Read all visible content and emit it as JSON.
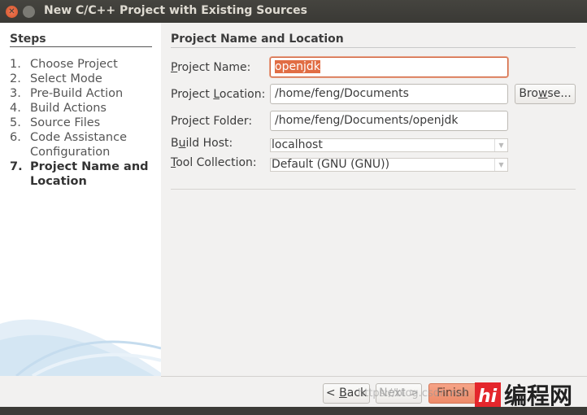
{
  "window": {
    "title": "New C/C++ Project with Existing Sources"
  },
  "steps": {
    "heading": "Steps",
    "items": [
      {
        "num": "1.",
        "label": "Choose Project"
      },
      {
        "num": "2.",
        "label": "Select Mode"
      },
      {
        "num": "3.",
        "label": "Pre-Build Action"
      },
      {
        "num": "4.",
        "label": "Build Actions"
      },
      {
        "num": "5.",
        "label": "Source Files"
      },
      {
        "num": "6.",
        "label": "Code Assistance Configuration"
      },
      {
        "num": "7.",
        "label": "Project Name and Location",
        "current": true
      }
    ]
  },
  "form": {
    "heading": "Project Name and Location",
    "project_name": {
      "label_u": "P",
      "label_rest": "roject Name:",
      "value": "openjdk"
    },
    "project_location": {
      "label_pre": "Project ",
      "label_u": "L",
      "label_rest": "ocation:",
      "value": "/home/feng/Documents"
    },
    "project_folder": {
      "label": "Project Folder:",
      "value": "/home/feng/Documents/openjdk"
    },
    "build_host": {
      "label_pre": "B",
      "label_u": "u",
      "label_rest": "ild Host:",
      "value": "localhost"
    },
    "tool_collection": {
      "label_u": "T",
      "label_rest": "ool Collection:",
      "value": "Default (GNU (GNU))"
    },
    "browse_pre": "Bro",
    "browse_u": "w",
    "browse_rest": "se..."
  },
  "buttons": {
    "back_pre": "< ",
    "back_u": "B",
    "back_rest": "ack",
    "next": "Next >",
    "finish": "Finish"
  },
  "watermark": {
    "url": "https://blog.csdn.net",
    "logo_text": "编程网"
  },
  "colors": {
    "accent": "#e16d44",
    "titlebar": "#3c3b37"
  }
}
